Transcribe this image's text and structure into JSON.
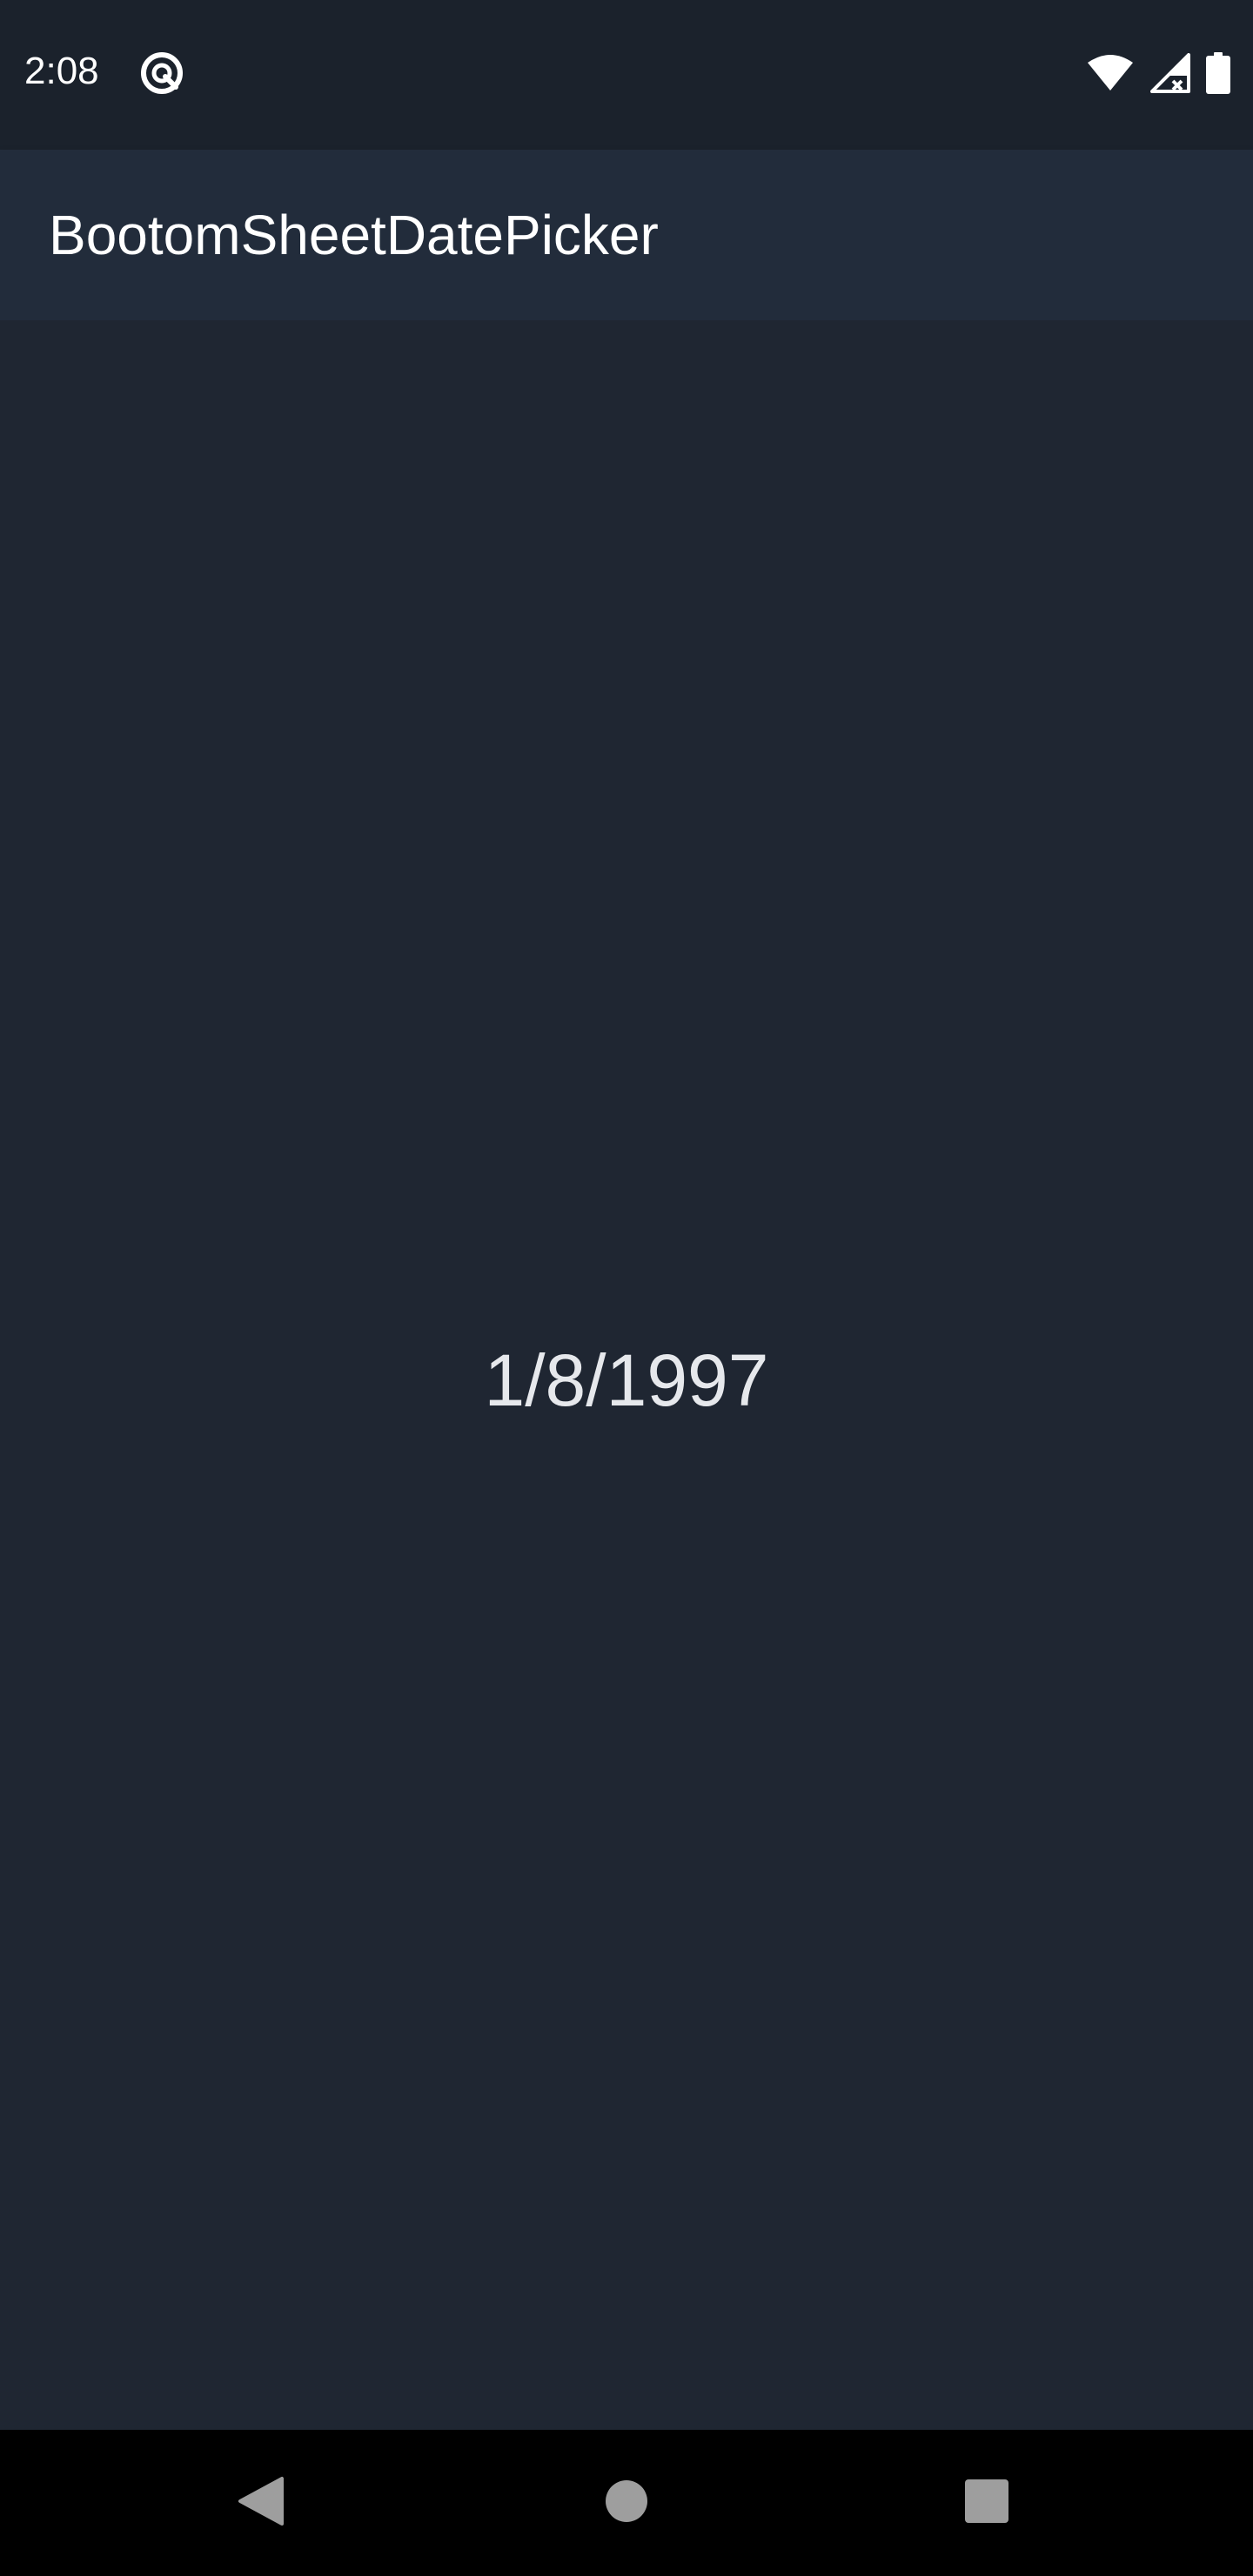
{
  "status_bar": {
    "time": "2:08",
    "icons": [
      "app-notification-icon",
      "wifi-icon",
      "signal-no-sim-icon",
      "battery-icon"
    ]
  },
  "app_bar": {
    "title": "BootomSheetDatePicker"
  },
  "main": {
    "selected_date": "1/8/1997"
  },
  "nav_bar": {
    "buttons": [
      "back-icon",
      "home-icon",
      "recents-icon"
    ]
  },
  "colors": {
    "background": "#1f2632",
    "status_bar": "#1b222c",
    "app_bar": "#222c3b",
    "nav_bar": "#000000",
    "text_primary": "#ffffff",
    "nav_icon": "#9e9e9e"
  }
}
